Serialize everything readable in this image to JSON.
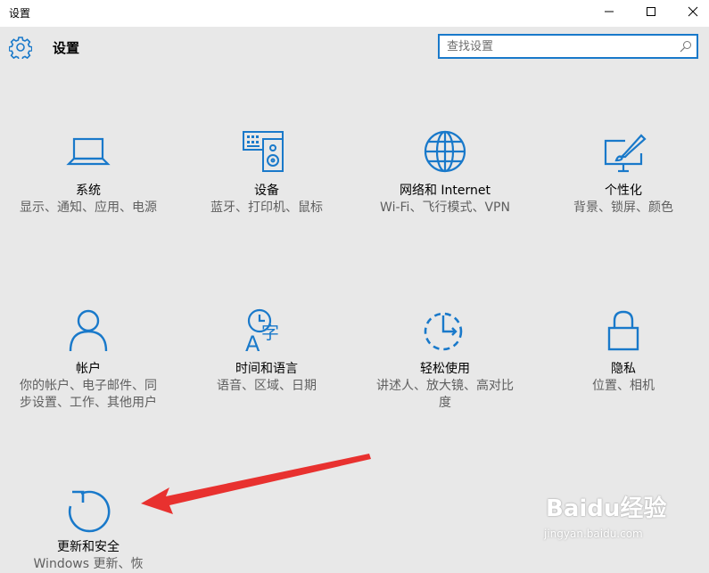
{
  "window": {
    "title": "设置",
    "minimize": "minimize-icon",
    "maximize": "maximize-icon",
    "close": "close-icon"
  },
  "header": {
    "title": "设置",
    "icon": "gear-icon"
  },
  "search": {
    "placeholder": "查找设置",
    "icon": "search-icon"
  },
  "accent_color": "#1979ca",
  "categories": [
    {
      "name": "系统",
      "desc": "显示、通知、应用、电源",
      "icon": "laptop-icon"
    },
    {
      "name": "设备",
      "desc": "蓝牙、打印机、鼠标",
      "icon": "keyboard-speaker-icon"
    },
    {
      "name": "网络和 Internet",
      "desc": "Wi-Fi、飞行模式、VPN",
      "icon": "globe-icon"
    },
    {
      "name": "个性化",
      "desc": "背景、锁屏、颜色",
      "icon": "paint-monitor-icon"
    },
    {
      "name": "帐户",
      "desc": "你的帐户、电子邮件、同步设置、工作、其他用户",
      "icon": "person-icon"
    },
    {
      "name": "时间和语言",
      "desc": "语音、区域、日期",
      "icon": "clock-language-icon"
    },
    {
      "name": "轻松使用",
      "desc": "讲述人、放大镜、高对比度",
      "icon": "ease-of-access-icon"
    },
    {
      "name": "隐私",
      "desc": "位置、相机",
      "icon": "lock-icon"
    },
    {
      "name": "更新和安全",
      "desc": "Windows 更新、恢",
      "icon": "refresh-icon"
    }
  ],
  "annotation": {
    "icon": "red-arrow-icon",
    "color": "#e8312f"
  },
  "watermark": {
    "brand": "Baidu经验",
    "url": "jingyan.baidu.com"
  }
}
